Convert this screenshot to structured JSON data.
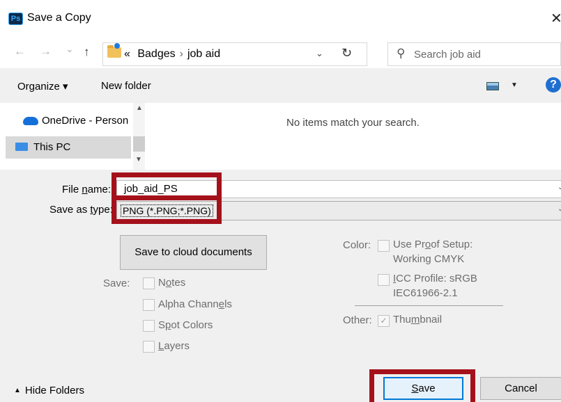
{
  "window": {
    "title": "Save a Copy",
    "app_icon_text": "Ps",
    "close_glyph": "✕"
  },
  "navbar": {
    "back_glyph": "←",
    "forward_glyph": "→",
    "recent_glyph": "⌄",
    "up_glyph": "↑",
    "breadcrumb_prefix": "«",
    "breadcrumb": [
      "Badges",
      "job aid"
    ],
    "breadcrumb_separator": "›",
    "dropdown_glyph": "⌄",
    "refresh_glyph": "↻",
    "search_placeholder": "Search job aid",
    "search_glyph": "⚲"
  },
  "commandbar": {
    "organize": "Organize ▾",
    "new_folder": "New folder",
    "view_dropdown": "▼",
    "help": "?"
  },
  "navpane": {
    "items": [
      {
        "label": "OneDrive - Person"
      },
      {
        "label": "This PC"
      }
    ],
    "scroll_up": "▲",
    "scroll_down": "▼"
  },
  "filearea": {
    "empty_message": "No items match your search."
  },
  "form": {
    "file_name_label_pre": "File ",
    "file_name_label_u": "n",
    "file_name_label_post": "ame:",
    "file_name_value": "job_aid_PS",
    "save_as_type_label_pre": "Save as ",
    "save_as_type_label_u": "t",
    "save_as_type_label_post": "ype:",
    "save_as_type_value": "PNG (*.PNG;*.PNG)",
    "chevron": "⌄"
  },
  "options": {
    "cloud_button": "Save to cloud documents",
    "save_label": "Save:",
    "notes_pre": "N",
    "notes_u": "o",
    "notes_post": "tes",
    "alpha_pre": "Alpha Chann",
    "alpha_u": "e",
    "alpha_post": "ls",
    "spot_pre": "S",
    "spot_u": "p",
    "spot_post": "ot Colors",
    "layers_pre": "",
    "layers_u": "L",
    "layers_post": "ayers",
    "color_label": "Color:",
    "proof_pre": "Use Pr",
    "proof_u": "o",
    "proof_post": "of Setup:",
    "proof_line2": "Working CMYK",
    "icc_pre": "",
    "icc_u": "I",
    "icc_post": "CC Profile:  sRGB",
    "icc_line2": "IEC61966-2.1",
    "other_label": "Other:",
    "thumb_pre": "Thu",
    "thumb_u": "m",
    "thumb_post": "bnail",
    "thumb_check": "✓"
  },
  "footer": {
    "hide_folders": "Hide Folders",
    "hide_chevron": "▲",
    "save_pre": "",
    "save_u": "S",
    "save_post": "ave",
    "cancel": "Cancel"
  },
  "annotation": {
    "color": "#a5111b"
  }
}
